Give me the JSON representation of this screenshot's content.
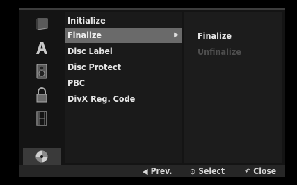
{
  "sidebar_icons": [
    {
      "name": "disc-tray-icon",
      "selected": false
    },
    {
      "name": "language-letter-a-icon",
      "selected": false
    },
    {
      "name": "speaker-audio-icon",
      "selected": false
    },
    {
      "name": "padlock-lock-icon",
      "selected": false
    },
    {
      "name": "film-strip-icon",
      "selected": false
    },
    {
      "name": "disc-icon",
      "selected": true
    }
  ],
  "menu": {
    "items": [
      {
        "label": "Initialize"
      },
      {
        "label": "Finalize",
        "selected": true,
        "arrow": "▶"
      },
      {
        "label": "Disc Label"
      },
      {
        "label": "Disc Protect"
      },
      {
        "label": "PBC"
      },
      {
        "label": "DivX Reg. Code"
      }
    ]
  },
  "submenu": {
    "items": [
      {
        "label": "Finalize",
        "enabled": true
      },
      {
        "label": "Unfinalize",
        "enabled": false
      }
    ]
  },
  "footer": {
    "prev_symbol": "◀",
    "prev_label": "Prev.",
    "select_symbol": "⊙",
    "select_label": "Select",
    "close_symbol": "↶",
    "close_label": "Close"
  },
  "colors": {
    "background": "#000000",
    "panel": "#141414",
    "highlight": "#6a6a6a",
    "disabled_text": "#4e4e4e"
  }
}
